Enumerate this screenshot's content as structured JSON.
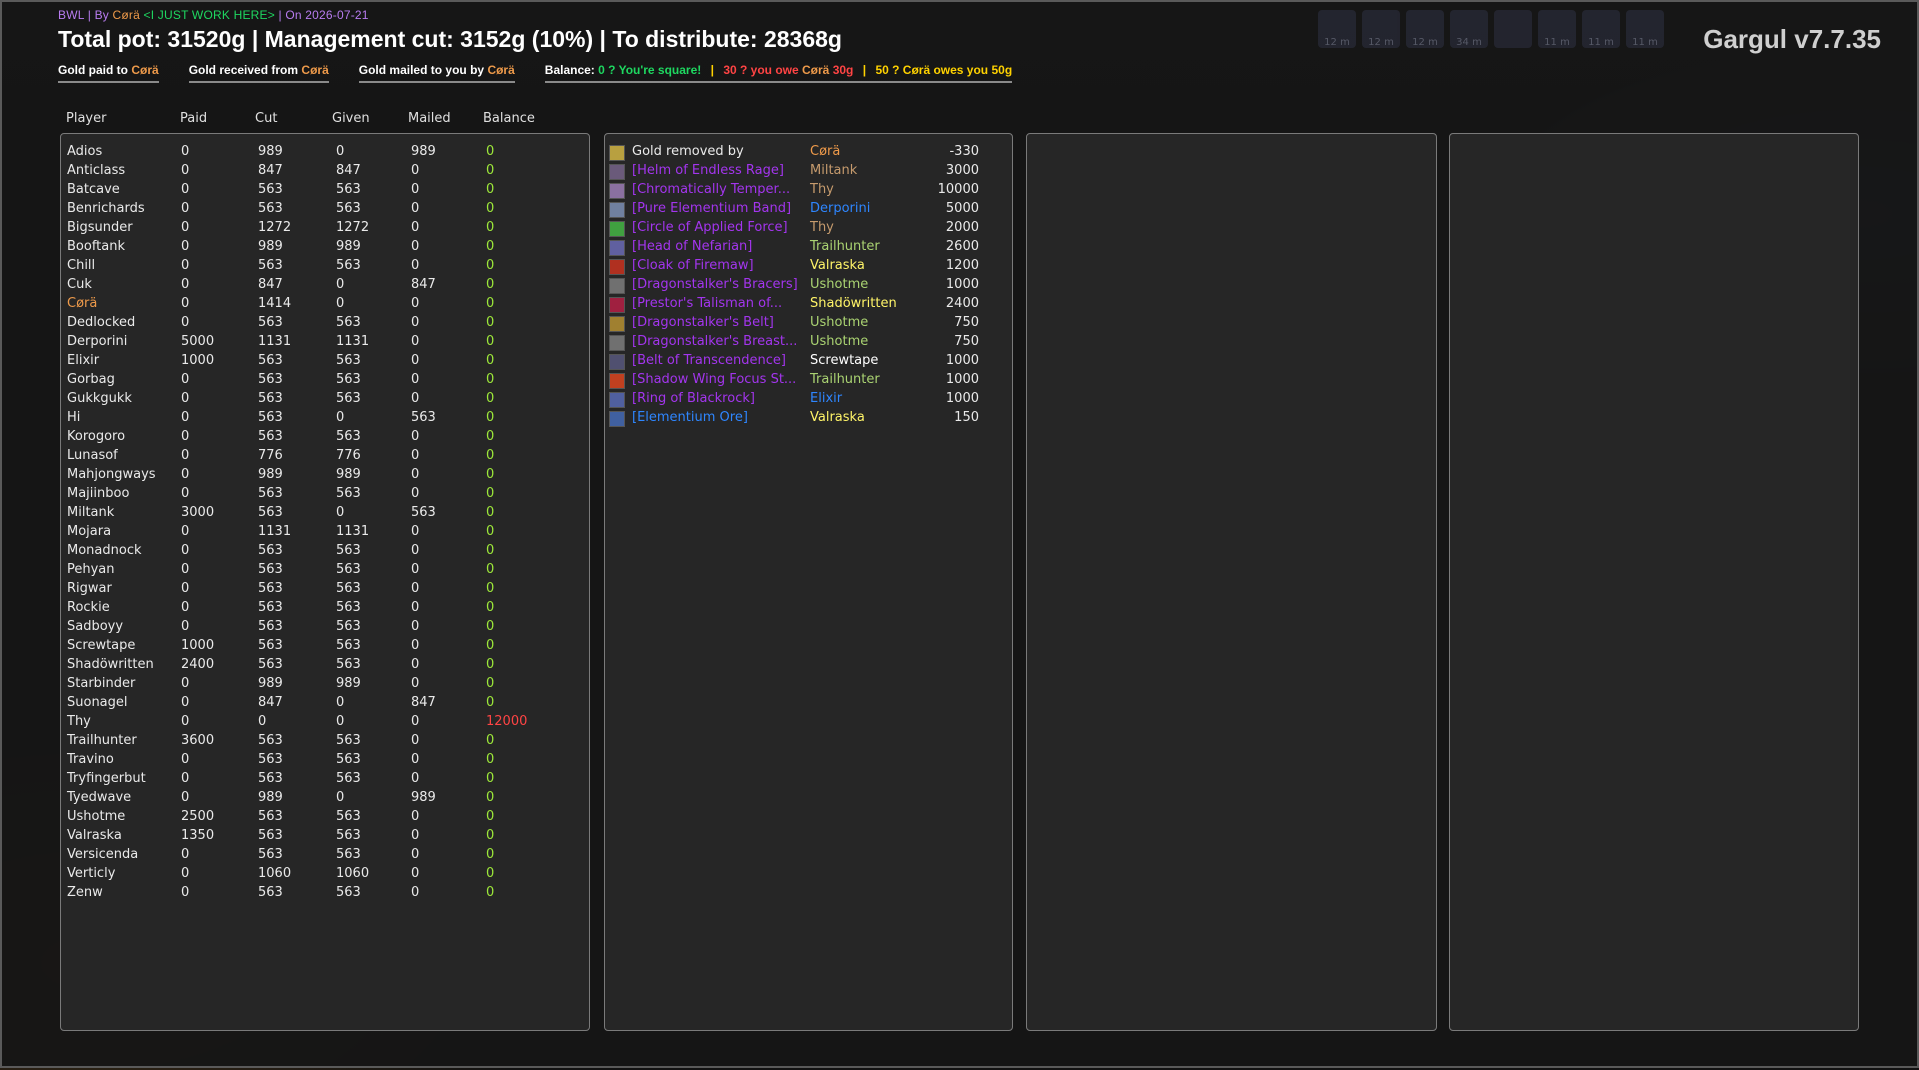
{
  "header": {
    "raid": "BWL",
    "by": "By",
    "author": "Cørä",
    "guild": "<I JUST WORK HERE>",
    "on": "On",
    "date": "2026-07-21"
  },
  "totals": {
    "text": "Total pot: 31520g | Management cut: 3152g (10%) | To distribute: 28368g"
  },
  "version": "Gargul v7.7.35",
  "top_icons": [
    {
      "icon": "buff-icon",
      "time": "12 m"
    },
    {
      "icon": "buff-icon",
      "time": "12 m"
    },
    {
      "icon": "buff-icon",
      "time": "12 m"
    },
    {
      "icon": "buff-icon",
      "time": "34 m"
    },
    {
      "icon": "buff-icon",
      "time": ""
    },
    {
      "icon": "buff-icon",
      "time": "11 m"
    },
    {
      "icon": "buff-icon",
      "time": "11 m"
    },
    {
      "icon": "buff-icon",
      "time": "11 m"
    }
  ],
  "tabs": {
    "paid_label": "Gold paid to",
    "paid_name": "Cørä",
    "received_label": "Gold received from",
    "received_name": "Cørä",
    "mailed_label": "Gold mailed to you by",
    "mailed_name": "Cørä",
    "balance_label": "Balance:",
    "balance_square": "0 ? You're square!",
    "balance_owe_pre": "30 ? you owe",
    "balance_owe_name": "Cørä",
    "balance_owe_amt": "30g",
    "balance_owed": "50 ? Cørä owes you 50g",
    "sep": "|"
  },
  "columns": {
    "player": "Player",
    "paid": "Paid",
    "cut": "Cut",
    "given": "Given",
    "mailed": "Mailed",
    "balance": "Balance"
  },
  "players": [
    {
      "name": "Adios",
      "paid": "0",
      "cut": "989",
      "given": "0",
      "mailed": "989",
      "balance": "0"
    },
    {
      "name": "Anticlass",
      "paid": "0",
      "cut": "847",
      "given": "847",
      "mailed": "0",
      "balance": "0"
    },
    {
      "name": "Batcave",
      "paid": "0",
      "cut": "563",
      "given": "563",
      "mailed": "0",
      "balance": "0"
    },
    {
      "name": "Benrichards",
      "paid": "0",
      "cut": "563",
      "given": "563",
      "mailed": "0",
      "balance": "0"
    },
    {
      "name": "Bigsunder",
      "paid": "0",
      "cut": "1272",
      "given": "1272",
      "mailed": "0",
      "balance": "0"
    },
    {
      "name": "Booftank",
      "paid": "0",
      "cut": "989",
      "given": "989",
      "mailed": "0",
      "balance": "0"
    },
    {
      "name": "Chill",
      "paid": "0",
      "cut": "563",
      "given": "563",
      "mailed": "0",
      "balance": "0"
    },
    {
      "name": "Cuk",
      "paid": "0",
      "cut": "847",
      "given": "0",
      "mailed": "847",
      "balance": "0"
    },
    {
      "name": "Cørä",
      "paid": "0",
      "cut": "1414",
      "given": "0",
      "mailed": "0",
      "balance": "0",
      "highlight": "#ee9a4a"
    },
    {
      "name": "Dedlocked",
      "paid": "0",
      "cut": "563",
      "given": "563",
      "mailed": "0",
      "balance": "0"
    },
    {
      "name": "Derporini",
      "paid": "5000",
      "cut": "1131",
      "given": "1131",
      "mailed": "0",
      "balance": "0"
    },
    {
      "name": "Elixir",
      "paid": "1000",
      "cut": "563",
      "given": "563",
      "mailed": "0",
      "balance": "0"
    },
    {
      "name": "Gorbag",
      "paid": "0",
      "cut": "563",
      "given": "563",
      "mailed": "0",
      "balance": "0"
    },
    {
      "name": "Gukkgukk",
      "paid": "0",
      "cut": "563",
      "given": "563",
      "mailed": "0",
      "balance": "0"
    },
    {
      "name": "Hi",
      "paid": "0",
      "cut": "563",
      "given": "0",
      "mailed": "563",
      "balance": "0"
    },
    {
      "name": "Korogoro",
      "paid": "0",
      "cut": "563",
      "given": "563",
      "mailed": "0",
      "balance": "0"
    },
    {
      "name": "Lunasof",
      "paid": "0",
      "cut": "776",
      "given": "776",
      "mailed": "0",
      "balance": "0"
    },
    {
      "name": "Mahjongways",
      "paid": "0",
      "cut": "989",
      "given": "989",
      "mailed": "0",
      "balance": "0"
    },
    {
      "name": "Majiinboo",
      "paid": "0",
      "cut": "563",
      "given": "563",
      "mailed": "0",
      "balance": "0"
    },
    {
      "name": "Miltank",
      "paid": "3000",
      "cut": "563",
      "given": "0",
      "mailed": "563",
      "balance": "0"
    },
    {
      "name": "Mojara",
      "paid": "0",
      "cut": "1131",
      "given": "1131",
      "mailed": "0",
      "balance": "0"
    },
    {
      "name": "Monadnock",
      "paid": "0",
      "cut": "563",
      "given": "563",
      "mailed": "0",
      "balance": "0"
    },
    {
      "name": "Pehyan",
      "paid": "0",
      "cut": "563",
      "given": "563",
      "mailed": "0",
      "balance": "0"
    },
    {
      "name": "Rigwar",
      "paid": "0",
      "cut": "563",
      "given": "563",
      "mailed": "0",
      "balance": "0"
    },
    {
      "name": "Rockie",
      "paid": "0",
      "cut": "563",
      "given": "563",
      "mailed": "0",
      "balance": "0"
    },
    {
      "name": "Sadboyy",
      "paid": "0",
      "cut": "563",
      "given": "563",
      "mailed": "0",
      "balance": "0"
    },
    {
      "name": "Screwtape",
      "paid": "1000",
      "cut": "563",
      "given": "563",
      "mailed": "0",
      "balance": "0"
    },
    {
      "name": "Shadöwritten",
      "paid": "2400",
      "cut": "563",
      "given": "563",
      "mailed": "0",
      "balance": "0"
    },
    {
      "name": "Starbinder",
      "paid": "0",
      "cut": "989",
      "given": "989",
      "mailed": "0",
      "balance": "0"
    },
    {
      "name": "Suonagel",
      "paid": "0",
      "cut": "847",
      "given": "0",
      "mailed": "847",
      "balance": "0"
    },
    {
      "name": "Thy",
      "paid": "0",
      "cut": "0",
      "given": "0",
      "mailed": "0",
      "balance": "12000",
      "balance_color": "#ff4444"
    },
    {
      "name": "Trailhunter",
      "paid": "3600",
      "cut": "563",
      "given": "563",
      "mailed": "0",
      "balance": "0"
    },
    {
      "name": "Travino",
      "paid": "0",
      "cut": "563",
      "given": "563",
      "mailed": "0",
      "balance": "0"
    },
    {
      "name": "Tryfingerbut",
      "paid": "0",
      "cut": "563",
      "given": "563",
      "mailed": "0",
      "balance": "0"
    },
    {
      "name": "Tyedwave",
      "paid": "0",
      "cut": "989",
      "given": "0",
      "mailed": "989",
      "balance": "0"
    },
    {
      "name": "Ushotme",
      "paid": "2500",
      "cut": "563",
      "given": "563",
      "mailed": "0",
      "balance": "0"
    },
    {
      "name": "Valraska",
      "paid": "1350",
      "cut": "563",
      "given": "563",
      "mailed": "0",
      "balance": "0"
    },
    {
      "name": "Versicenda",
      "paid": "0",
      "cut": "563",
      "given": "563",
      "mailed": "0",
      "balance": "0"
    },
    {
      "name": "Verticly",
      "paid": "0",
      "cut": "1060",
      "given": "1060",
      "mailed": "0",
      "balance": "0"
    },
    {
      "name": "Zenw",
      "paid": "0",
      "cut": "563",
      "given": "563",
      "mailed": "0",
      "balance": "0"
    }
  ],
  "loot": [
    {
      "item": "Gold removed by",
      "item_color": "#eaeaea",
      "who": "Cørä",
      "who_color": "#ee9a4a",
      "amount": "-330",
      "icon": "gold-coin-icon",
      "icon_color": "#b8a040"
    },
    {
      "item": "[Helm of Endless Rage]",
      "item_color": "#a335ee",
      "who": "Miltank",
      "who_color": "#c69b6d",
      "amount": "3000",
      "icon": "helm-icon",
      "icon_color": "#6a5a7a"
    },
    {
      "item": "[Chromatically Temper...",
      "item_color": "#a335ee",
      "who": "Thy",
      "who_color": "#c69b6d",
      "amount": "10000",
      "icon": "gloves-icon",
      "icon_color": "#8a70a0"
    },
    {
      "item": "[Pure Elementium Band]",
      "item_color": "#a335ee",
      "who": "Derporini",
      "who_color": "#2e86ff",
      "amount": "5000",
      "icon": "ring-icon",
      "icon_color": "#7080a0"
    },
    {
      "item": "[Circle of Applied Force]",
      "item_color": "#a335ee",
      "who": "Thy",
      "who_color": "#c69b6d",
      "amount": "2000",
      "icon": "ring-icon",
      "icon_color": "#40a040"
    },
    {
      "item": "[Head of Nefarian]",
      "item_color": "#a335ee",
      "who": "Trailhunter",
      "who_color": "#aad372",
      "amount": "2600",
      "icon": "head-icon",
      "icon_color": "#6060a0"
    },
    {
      "item": "[Cloak of Firemaw]",
      "item_color": "#a335ee",
      "who": "Valraska",
      "who_color": "#fff468",
      "amount": "1200",
      "icon": "cloak-icon",
      "icon_color": "#b03020"
    },
    {
      "item": "[Dragonstalker's Bracers]",
      "item_color": "#a335ee",
      "who": "Ushotme",
      "who_color": "#aad372",
      "amount": "1000",
      "icon": "bracers-icon",
      "icon_color": "#707070"
    },
    {
      "item": "[Prestor's Talisman of...",
      "item_color": "#a335ee",
      "who": "Shadöwritten",
      "who_color": "#fff468",
      "amount": "2400",
      "icon": "talisman-icon",
      "icon_color": "#a02040"
    },
    {
      "item": "[Dragonstalker's Belt]",
      "item_color": "#a335ee",
      "who": "Ushotme",
      "who_color": "#aad372",
      "amount": "750",
      "icon": "belt-icon",
      "icon_color": "#a08030"
    },
    {
      "item": "[Dragonstalker's Breast...",
      "item_color": "#a335ee",
      "who": "Ushotme",
      "who_color": "#aad372",
      "amount": "750",
      "icon": "chest-icon",
      "icon_color": "#707070"
    },
    {
      "item": "[Belt of Transcendence]",
      "item_color": "#a335ee",
      "who": "Screwtape",
      "who_color": "#ffffff",
      "amount": "1000",
      "icon": "belt-icon",
      "icon_color": "#505070"
    },
    {
      "item": "[Shadow Wing Focus St...",
      "item_color": "#a335ee",
      "who": "Trailhunter",
      "who_color": "#aad372",
      "amount": "1000",
      "icon": "staff-icon",
      "icon_color": "#c04020"
    },
    {
      "item": "[Ring of Blackrock]",
      "item_color": "#a335ee",
      "who": "Elixir",
      "who_color": "#2e86ff",
      "amount": "1000",
      "icon": "ring-icon",
      "icon_color": "#5060a0"
    },
    {
      "item": "[Elementium Ore]",
      "item_color": "#2e86ff",
      "who": "Valraska",
      "who_color": "#fff468",
      "amount": "150",
      "icon": "ore-icon",
      "icon_color": "#4060a0"
    }
  ]
}
